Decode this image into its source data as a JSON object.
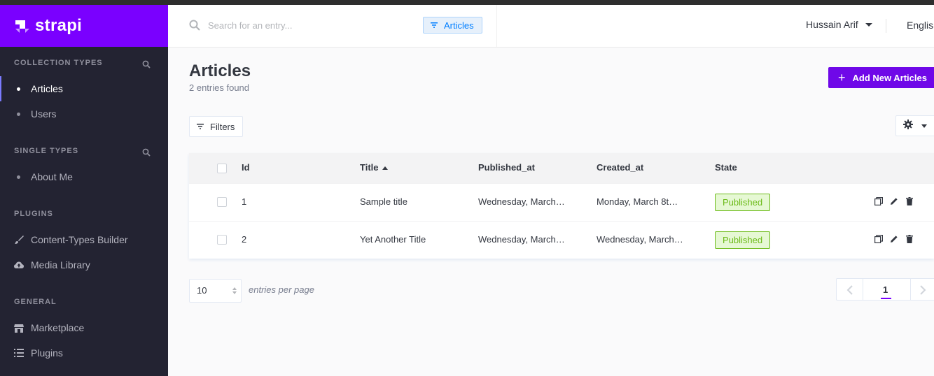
{
  "brand": {
    "name": "strapi"
  },
  "sidebar": {
    "collection_types": {
      "heading": "COLLECTION TYPES",
      "items": [
        {
          "label": "Articles",
          "active": true
        },
        {
          "label": "Users",
          "active": false
        }
      ]
    },
    "single_types": {
      "heading": "SINGLE TYPES",
      "items": [
        {
          "label": "About Me"
        }
      ]
    },
    "plugins": {
      "heading": "PLUGINS",
      "items": [
        {
          "label": "Content-Types Builder",
          "icon": "paintbrush-icon"
        },
        {
          "label": "Media Library",
          "icon": "cloud-upload-icon"
        }
      ]
    },
    "general": {
      "heading": "GENERAL",
      "items": [
        {
          "label": "Marketplace",
          "icon": "shop-icon"
        },
        {
          "label": "Plugins",
          "icon": "list-icon"
        }
      ]
    }
  },
  "header": {
    "search_placeholder": "Search for an entry...",
    "search_filter_chip": "Articles",
    "user_name": "Hussain Arif",
    "language": "English"
  },
  "main": {
    "title": "Articles",
    "subtitle": "2 entries found",
    "add_button_label": "Add New Articles",
    "filters_label": "Filters",
    "table": {
      "columns": [
        "Id",
        "Title",
        "Published_at",
        "Created_at",
        "State"
      ],
      "sorted_column": "Title",
      "rows": [
        {
          "id": "1",
          "title": "Sample title",
          "published_at": "Wednesday, March…",
          "created_at": "Monday, March 8t…",
          "state": "Published"
        },
        {
          "id": "2",
          "title": "Yet Another Title",
          "published_at": "Wednesday, March…",
          "created_at": "Wednesday, March…",
          "state": "Published"
        }
      ]
    },
    "pagination": {
      "per_page": "10",
      "per_page_label": "entries per page",
      "current_page": "1"
    }
  },
  "colors": {
    "brand": "#7a00ff",
    "sidebar_bg": "#232332",
    "published_badge": "#6dbb1a",
    "chip_blue": "#007eff"
  }
}
